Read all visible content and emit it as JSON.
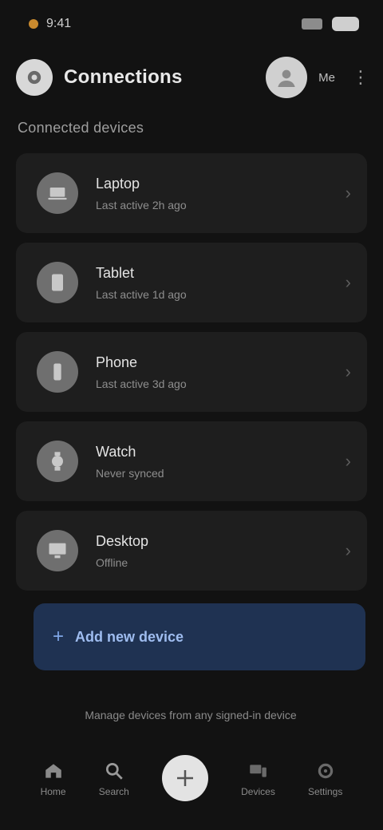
{
  "status": {
    "time": "9:41",
    "battery": "",
    "network": ""
  },
  "header": {
    "brand": "Connections",
    "account_label": "Me"
  },
  "section": {
    "title": "Connected devices"
  },
  "devices": [
    {
      "title": "Laptop",
      "subtitle": "Last active 2h ago"
    },
    {
      "title": "Tablet",
      "subtitle": "Last active 1d ago"
    },
    {
      "title": "Phone",
      "subtitle": "Last active 3d ago"
    },
    {
      "title": "Watch",
      "subtitle": "Never synced"
    },
    {
      "title": "Desktop",
      "subtitle": "Offline"
    }
  ],
  "actions": {
    "add_device": "Add new device"
  },
  "footer": {
    "hint": "Manage devices from any signed-in device"
  },
  "nav": [
    {
      "label": "Home",
      "icon": "home-icon"
    },
    {
      "label": "Search",
      "icon": "search-icon"
    },
    {
      "label": "",
      "icon": "plus-icon"
    },
    {
      "label": "Devices",
      "icon": "devices-icon"
    },
    {
      "label": "Settings",
      "icon": "gear-icon"
    }
  ],
  "colors": {
    "background": "#121212",
    "card": "#1e1e1e",
    "accent": "#1f3252"
  }
}
